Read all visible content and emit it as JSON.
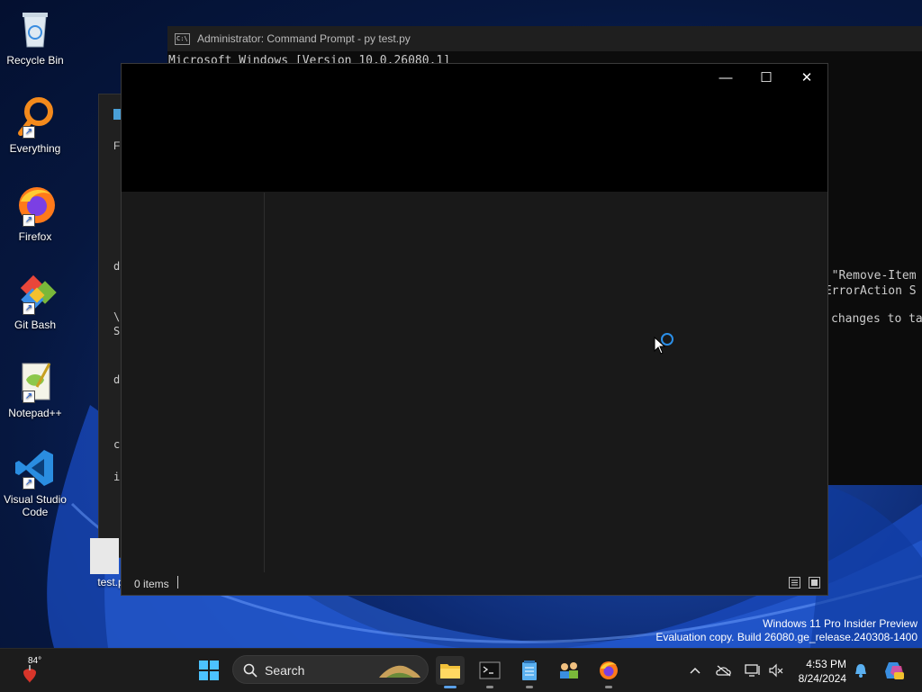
{
  "desktop": {
    "icons": [
      {
        "label": "Recycle Bin",
        "icon": "recycle-bin-icon"
      },
      {
        "label": "Everything",
        "icon": "everything-search-icon"
      },
      {
        "label": "Firefox",
        "icon": "firefox-icon"
      },
      {
        "label": "Git Bash",
        "icon": "git-bash-icon"
      },
      {
        "label": "Notepad++",
        "icon": "notepad-plus-plus-icon"
      },
      {
        "label": "Visual Studio Code",
        "label_line1": "Visual Studio",
        "label_line2": "Code",
        "icon": "vscode-icon"
      }
    ],
    "file": {
      "label": "test.py"
    }
  },
  "cmd_window": {
    "title": "Administrator: Command Prompt - py  test.py",
    "lines": [
      "Microsoft Windows [Version 10.0.26080.1]",
      "d \"Remove-Item",
      "-ErrorAction S",
      "changes to ta"
    ]
  },
  "explorer_back": {
    "menu_fragment": "Fi",
    "chars": [
      "d",
      "\\",
      "S",
      "d",
      "c",
      "i"
    ]
  },
  "main_window": {
    "controls": {
      "minimize": "—",
      "maximize": "☐",
      "close": "✕"
    },
    "status": {
      "items_text": "0 items"
    }
  },
  "watermark": {
    "line1": "Windows 11 Pro Insider Preview",
    "line2": "Evaluation copy. Build 26080.ge_release.240308-1400"
  },
  "taskbar": {
    "weather_temp": "84°",
    "search_label": "Search",
    "apps": [
      "start-icon",
      "file-explorer-icon",
      "terminal-icon",
      "notepad-icon",
      "people-icon",
      "firefox-icon"
    ],
    "clock_time": "4:53 PM",
    "clock_date": "8/24/2024"
  },
  "colors": {
    "accent": "#2b8fe8",
    "taskbar_bg": "#1c1c1c",
    "window_bg": "#191919"
  }
}
